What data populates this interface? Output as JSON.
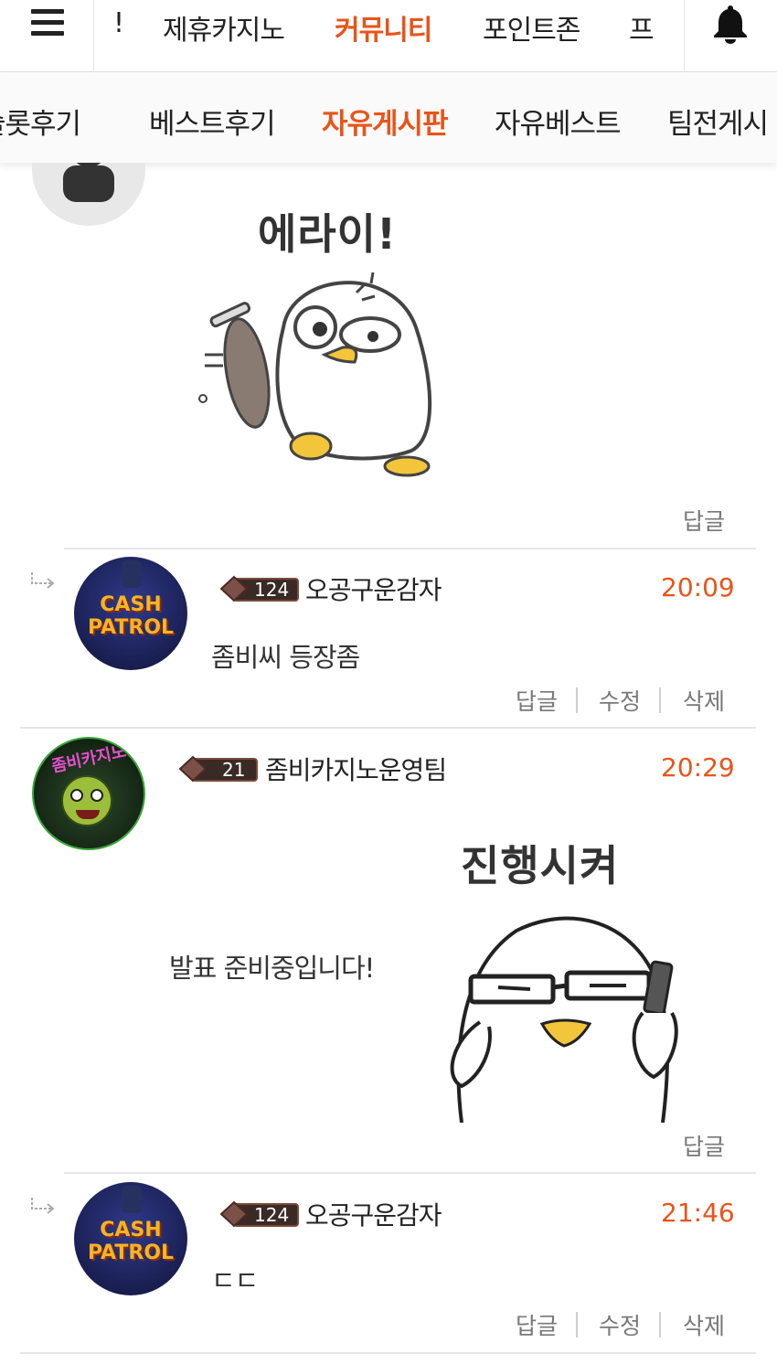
{
  "top_nav": {
    "items": [
      "!",
      "제휴카지노",
      "커뮤니티",
      "포인트존",
      "프"
    ],
    "active_index": 2
  },
  "sub_nav": {
    "items": [
      "슬롯후기",
      "베스트후기",
      "자유게시판",
      "자유베스트",
      "팀전게시"
    ],
    "active_index": 2
  },
  "comments": [
    {
      "sticker_caption": "에라이!",
      "reply_label": "답글"
    },
    {
      "is_reply": true,
      "avatar_text": [
        "CASH",
        "PATROL"
      ],
      "level": "124",
      "nickname": "오공구운감자",
      "time": "20:09",
      "text": "좀비씨 등장좀",
      "actions": [
        "답글",
        "수정",
        "삭제"
      ]
    },
    {
      "avatar_text": "좀비카지노",
      "level": "21",
      "nickname": "좀비카지노운영팀",
      "time": "20:29",
      "text": "발표 준비중입니다!",
      "sticker_caption": "진행시켜",
      "reply_label": "답글"
    },
    {
      "is_reply": true,
      "avatar_text": [
        "CASH",
        "PATROL"
      ],
      "level": "124",
      "nickname": "오공구운감자",
      "time": "21:46",
      "text": "ㄷㄷ",
      "actions": [
        "답글",
        "수정",
        "삭제"
      ]
    }
  ],
  "colors": {
    "accent": "#e8541a",
    "muted": "#777777",
    "divider": "#e6e6e6"
  },
  "icons": [
    "menu-icon",
    "bell-icon",
    "reply-arrow-icon",
    "level-badge-icon"
  ]
}
